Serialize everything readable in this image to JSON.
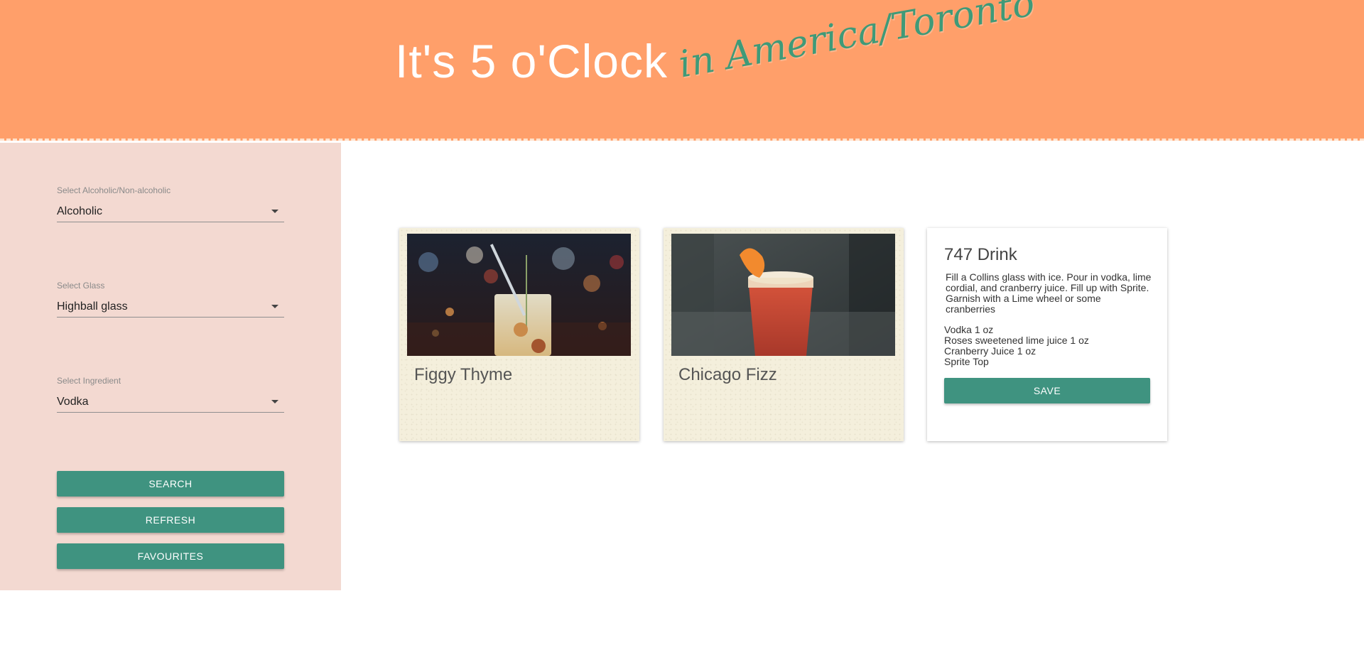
{
  "header": {
    "title": "It's 5 o'Clock",
    "subtitle": "in America/Toronto"
  },
  "sidebar": {
    "filters": [
      {
        "label": "Select Alcoholic/Non-alcoholic",
        "value": "Alcoholic"
      },
      {
        "label": "Select Glass",
        "value": "Highball glass"
      },
      {
        "label": "Select Ingredient",
        "value": "Vodka"
      }
    ],
    "buttons": {
      "search": "SEARCH",
      "refresh": "REFRESH",
      "favourites": "FAVOURITES"
    }
  },
  "results": [
    {
      "name": "Figgy Thyme"
    },
    {
      "name": "Chicago Fizz"
    }
  ],
  "detail": {
    "name": "747 Drink",
    "instructions": "Fill a Collins glass with ice. Pour in vodka, lime cordial, and cranberry juice. Fill up with Sprite. Garnish with a Lime wheel or some cranberries",
    "ingredients": [
      "Vodka 1 oz",
      "Roses sweetened lime juice 1 oz",
      "Cranberry Juice 1 oz",
      "Sprite Top"
    ],
    "save_label": "SAVE"
  },
  "colors": {
    "header_bg": "#ff9f6a",
    "accent_green": "#3f9380",
    "sidebar_bg": "#f3d9d1",
    "card_paper": "#f4efdc"
  }
}
